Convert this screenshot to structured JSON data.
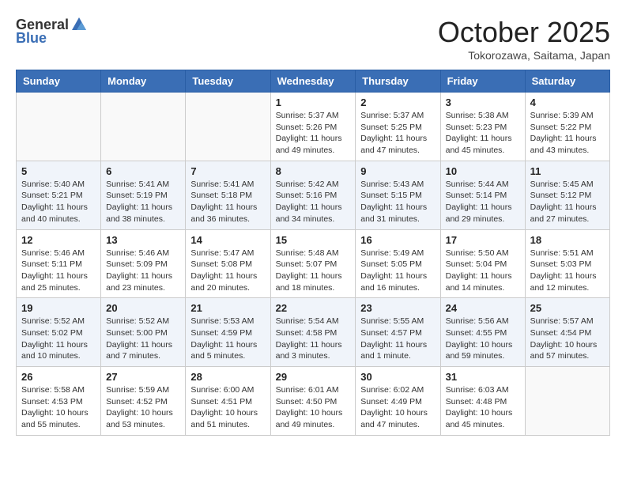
{
  "logo": {
    "general": "General",
    "blue": "Blue"
  },
  "title": {
    "month": "October 2025",
    "location": "Tokorozawa, Saitama, Japan"
  },
  "headers": [
    "Sunday",
    "Monday",
    "Tuesday",
    "Wednesday",
    "Thursday",
    "Friday",
    "Saturday"
  ],
  "weeks": [
    [
      {
        "day": "",
        "info": ""
      },
      {
        "day": "",
        "info": ""
      },
      {
        "day": "",
        "info": ""
      },
      {
        "day": "1",
        "info": "Sunrise: 5:37 AM\nSunset: 5:26 PM\nDaylight: 11 hours\nand 49 minutes."
      },
      {
        "day": "2",
        "info": "Sunrise: 5:37 AM\nSunset: 5:25 PM\nDaylight: 11 hours\nand 47 minutes."
      },
      {
        "day": "3",
        "info": "Sunrise: 5:38 AM\nSunset: 5:23 PM\nDaylight: 11 hours\nand 45 minutes."
      },
      {
        "day": "4",
        "info": "Sunrise: 5:39 AM\nSunset: 5:22 PM\nDaylight: 11 hours\nand 43 minutes."
      }
    ],
    [
      {
        "day": "5",
        "info": "Sunrise: 5:40 AM\nSunset: 5:21 PM\nDaylight: 11 hours\nand 40 minutes."
      },
      {
        "day": "6",
        "info": "Sunrise: 5:41 AM\nSunset: 5:19 PM\nDaylight: 11 hours\nand 38 minutes."
      },
      {
        "day": "7",
        "info": "Sunrise: 5:41 AM\nSunset: 5:18 PM\nDaylight: 11 hours\nand 36 minutes."
      },
      {
        "day": "8",
        "info": "Sunrise: 5:42 AM\nSunset: 5:16 PM\nDaylight: 11 hours\nand 34 minutes."
      },
      {
        "day": "9",
        "info": "Sunrise: 5:43 AM\nSunset: 5:15 PM\nDaylight: 11 hours\nand 31 minutes."
      },
      {
        "day": "10",
        "info": "Sunrise: 5:44 AM\nSunset: 5:14 PM\nDaylight: 11 hours\nand 29 minutes."
      },
      {
        "day": "11",
        "info": "Sunrise: 5:45 AM\nSunset: 5:12 PM\nDaylight: 11 hours\nand 27 minutes."
      }
    ],
    [
      {
        "day": "12",
        "info": "Sunrise: 5:46 AM\nSunset: 5:11 PM\nDaylight: 11 hours\nand 25 minutes."
      },
      {
        "day": "13",
        "info": "Sunrise: 5:46 AM\nSunset: 5:09 PM\nDaylight: 11 hours\nand 23 minutes."
      },
      {
        "day": "14",
        "info": "Sunrise: 5:47 AM\nSunset: 5:08 PM\nDaylight: 11 hours\nand 20 minutes."
      },
      {
        "day": "15",
        "info": "Sunrise: 5:48 AM\nSunset: 5:07 PM\nDaylight: 11 hours\nand 18 minutes."
      },
      {
        "day": "16",
        "info": "Sunrise: 5:49 AM\nSunset: 5:05 PM\nDaylight: 11 hours\nand 16 minutes."
      },
      {
        "day": "17",
        "info": "Sunrise: 5:50 AM\nSunset: 5:04 PM\nDaylight: 11 hours\nand 14 minutes."
      },
      {
        "day": "18",
        "info": "Sunrise: 5:51 AM\nSunset: 5:03 PM\nDaylight: 11 hours\nand 12 minutes."
      }
    ],
    [
      {
        "day": "19",
        "info": "Sunrise: 5:52 AM\nSunset: 5:02 PM\nDaylight: 11 hours\nand 10 minutes."
      },
      {
        "day": "20",
        "info": "Sunrise: 5:52 AM\nSunset: 5:00 PM\nDaylight: 11 hours\nand 7 minutes."
      },
      {
        "day": "21",
        "info": "Sunrise: 5:53 AM\nSunset: 4:59 PM\nDaylight: 11 hours\nand 5 minutes."
      },
      {
        "day": "22",
        "info": "Sunrise: 5:54 AM\nSunset: 4:58 PM\nDaylight: 11 hours\nand 3 minutes."
      },
      {
        "day": "23",
        "info": "Sunrise: 5:55 AM\nSunset: 4:57 PM\nDaylight: 11 hours\nand 1 minute."
      },
      {
        "day": "24",
        "info": "Sunrise: 5:56 AM\nSunset: 4:55 PM\nDaylight: 10 hours\nand 59 minutes."
      },
      {
        "day": "25",
        "info": "Sunrise: 5:57 AM\nSunset: 4:54 PM\nDaylight: 10 hours\nand 57 minutes."
      }
    ],
    [
      {
        "day": "26",
        "info": "Sunrise: 5:58 AM\nSunset: 4:53 PM\nDaylight: 10 hours\nand 55 minutes."
      },
      {
        "day": "27",
        "info": "Sunrise: 5:59 AM\nSunset: 4:52 PM\nDaylight: 10 hours\nand 53 minutes."
      },
      {
        "day": "28",
        "info": "Sunrise: 6:00 AM\nSunset: 4:51 PM\nDaylight: 10 hours\nand 51 minutes."
      },
      {
        "day": "29",
        "info": "Sunrise: 6:01 AM\nSunset: 4:50 PM\nDaylight: 10 hours\nand 49 minutes."
      },
      {
        "day": "30",
        "info": "Sunrise: 6:02 AM\nSunset: 4:49 PM\nDaylight: 10 hours\nand 47 minutes."
      },
      {
        "day": "31",
        "info": "Sunrise: 6:03 AM\nSunset: 4:48 PM\nDaylight: 10 hours\nand 45 minutes."
      },
      {
        "day": "",
        "info": ""
      }
    ]
  ]
}
